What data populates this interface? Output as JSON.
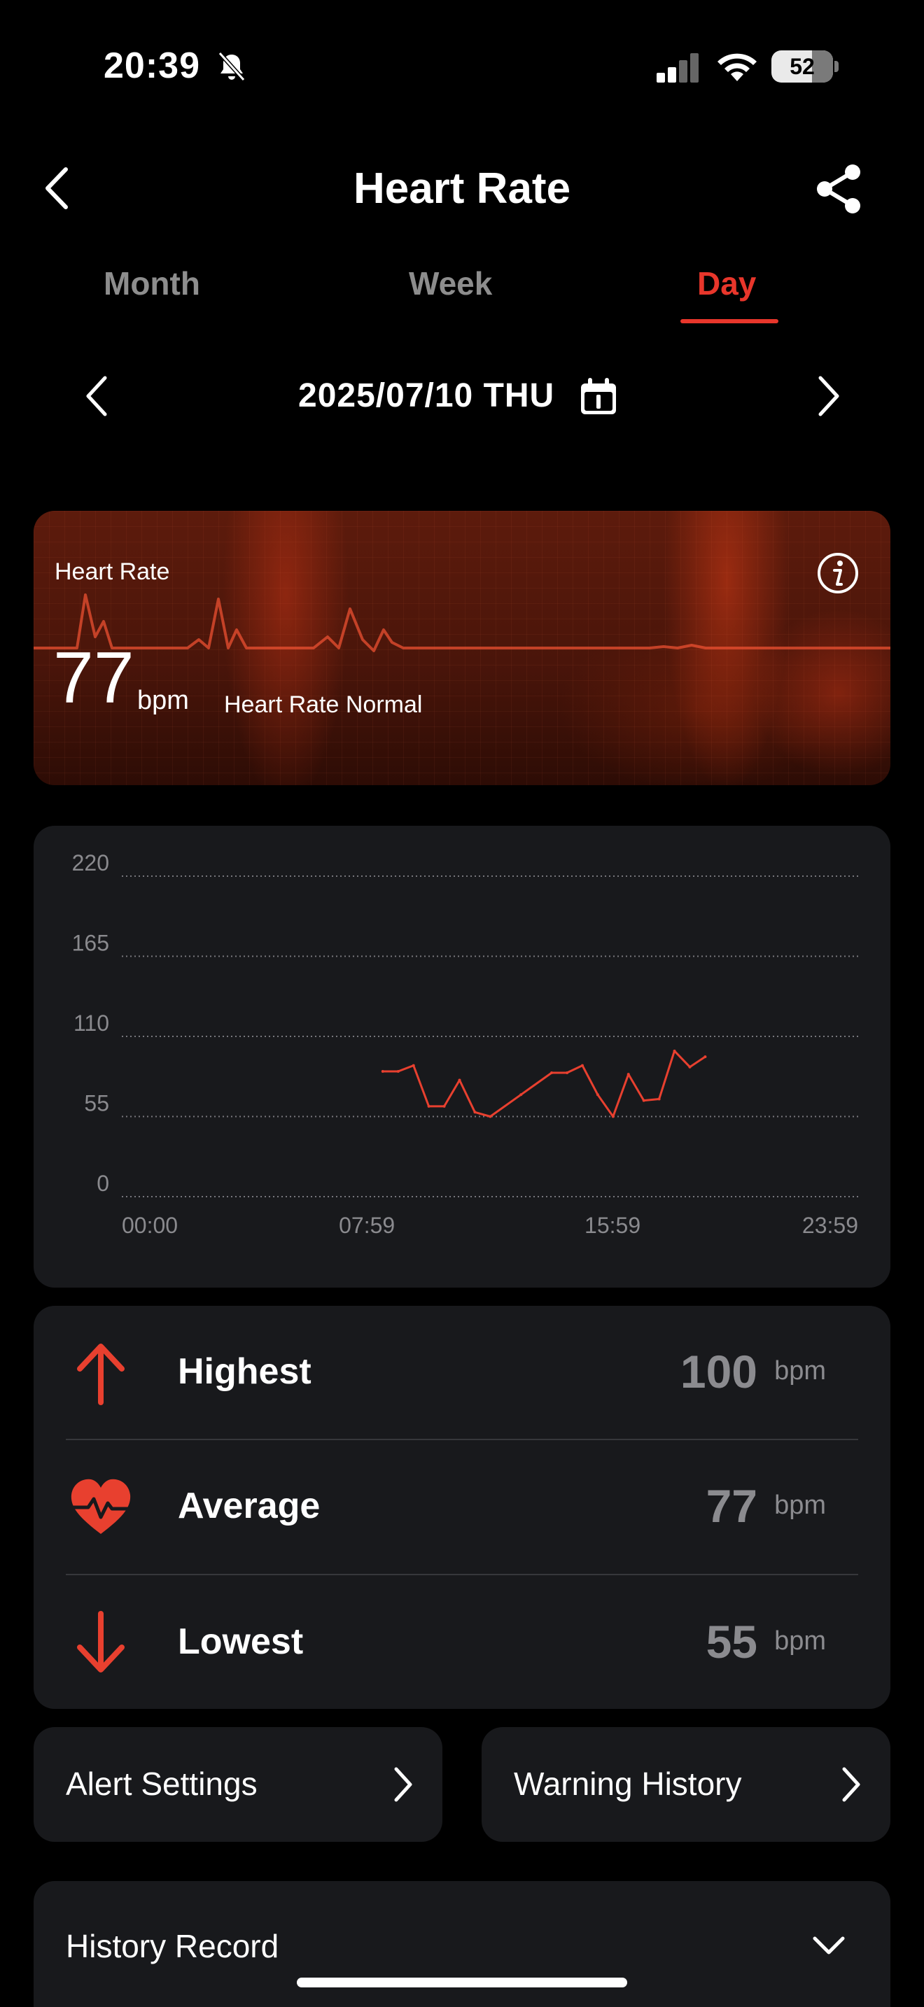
{
  "status_bar": {
    "time": "20:39",
    "battery": "52",
    "icons": [
      "bell-slash-icon",
      "cellular-signal-icon",
      "wifi-icon",
      "battery-icon"
    ]
  },
  "header": {
    "title": "Heart Rate",
    "back_icon": "chevron-left-icon",
    "share_icon": "share-icon"
  },
  "tabs": [
    {
      "label": "Month",
      "active": false
    },
    {
      "label": "Week",
      "active": false
    },
    {
      "label": "Day",
      "active": true
    }
  ],
  "date_nav": {
    "date": "2025/07/10 THU",
    "icon": "calendar-icon"
  },
  "hero": {
    "label": "Heart Rate",
    "value": "77",
    "unit": "bpm",
    "status": "Heart Rate Normal",
    "icon": "info-icon"
  },
  "chart_data": {
    "type": "line",
    "x_ticks": [
      "00:00",
      "07:59",
      "15:59",
      "23:59"
    ],
    "y_ticks": [
      "220",
      "165",
      "110",
      "55",
      "0"
    ],
    "ylim": [
      0,
      220
    ],
    "xlim": [
      "00:00",
      "23:59"
    ],
    "grid": true,
    "color": "#e8402f",
    "points": [
      {
        "x": "08:30",
        "y": 86
      },
      {
        "x": "09:00",
        "y": 86
      },
      {
        "x": "09:30",
        "y": 90
      },
      {
        "x": "10:00",
        "y": 62
      },
      {
        "x": "10:30",
        "y": 62
      },
      {
        "x": "11:00",
        "y": 80
      },
      {
        "x": "11:30",
        "y": 58
      },
      {
        "x": "12:00",
        "y": 55
      },
      {
        "x": "13:00",
        "y": 70
      },
      {
        "x": "14:00",
        "y": 85
      },
      {
        "x": "14:30",
        "y": 85
      },
      {
        "x": "15:00",
        "y": 90
      },
      {
        "x": "15:30",
        "y": 70
      },
      {
        "x": "16:00",
        "y": 55
      },
      {
        "x": "16:30",
        "y": 84
      },
      {
        "x": "17:00",
        "y": 66
      },
      {
        "x": "17:30",
        "y": 67
      },
      {
        "x": "18:00",
        "y": 100
      },
      {
        "x": "18:30",
        "y": 89
      },
      {
        "x": "19:00",
        "y": 96
      }
    ]
  },
  "stats": [
    {
      "label": "Highest",
      "value": "100",
      "unit": "bpm",
      "icon": "arrow-up-icon"
    },
    {
      "label": "Average",
      "value": "77",
      "unit": "bpm",
      "icon": "heart-pulse-icon"
    },
    {
      "label": "Lowest",
      "value": "55",
      "unit": "bpm",
      "icon": "arrow-down-icon"
    }
  ],
  "actions": {
    "alert_settings": "Alert Settings",
    "warning_history": "Warning History"
  },
  "history": {
    "label": "History Record"
  },
  "colors": {
    "accent": "#e8362b",
    "card": "#18191c",
    "muted": "#8b8b8f"
  }
}
